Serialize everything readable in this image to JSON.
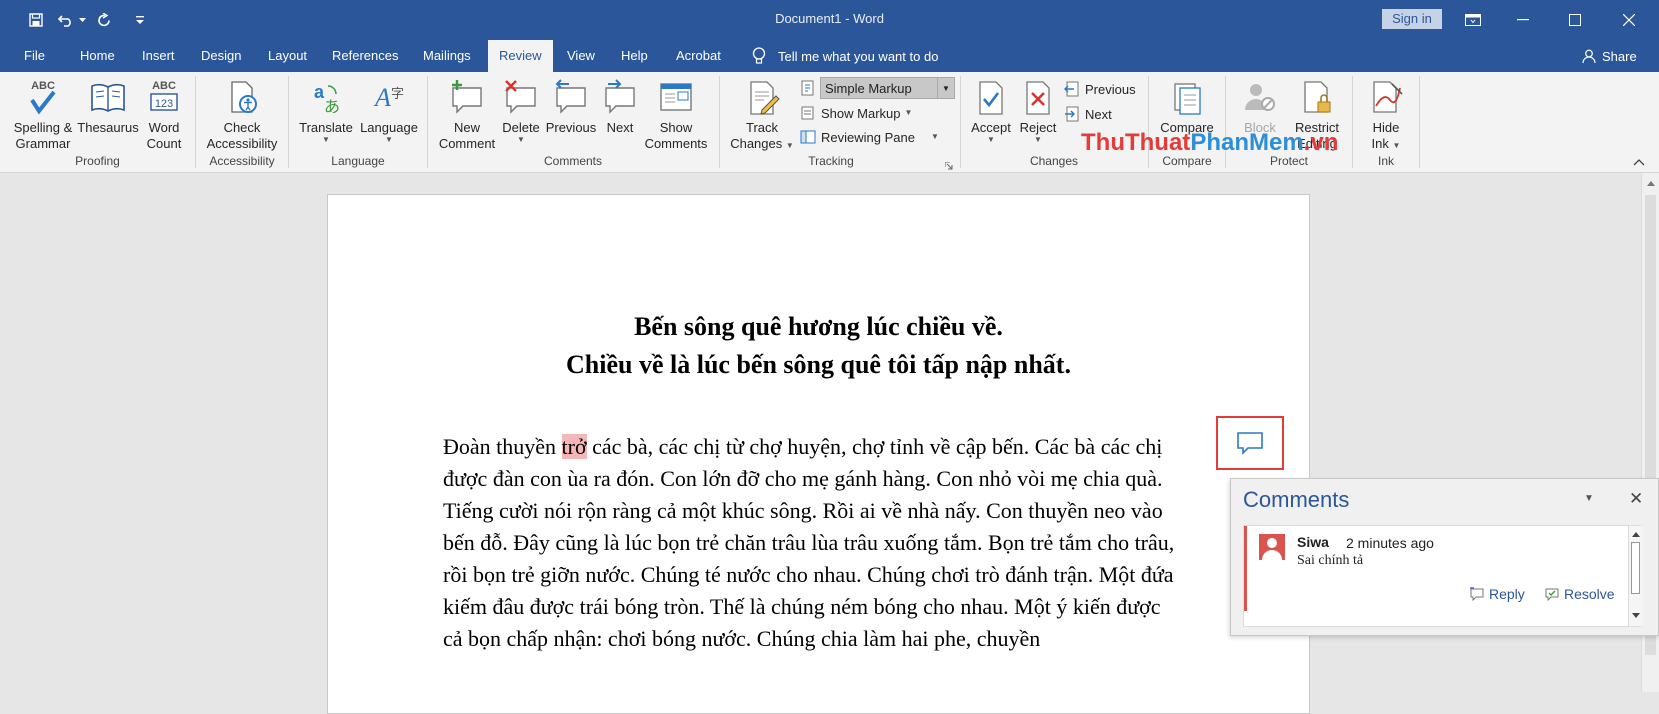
{
  "window": {
    "title": "Document1  -  Word",
    "signin": "Sign in"
  },
  "tabs": [
    {
      "label": "File",
      "active": false
    },
    {
      "label": "Home",
      "active": false
    },
    {
      "label": "Insert",
      "active": false
    },
    {
      "label": "Design",
      "active": false
    },
    {
      "label": "Layout",
      "active": false
    },
    {
      "label": "References",
      "active": false
    },
    {
      "label": "Mailings",
      "active": false
    },
    {
      "label": "Review",
      "active": true
    },
    {
      "label": "View",
      "active": false
    },
    {
      "label": "Help",
      "active": false
    },
    {
      "label": "Acrobat",
      "active": false
    }
  ],
  "tellme": "Tell me what you want to do",
  "share": "Share",
  "ribbon": {
    "proofing": {
      "group": "Proofing",
      "spelling": [
        "Spelling &",
        "Grammar"
      ],
      "spelling_icon_text": "ABC",
      "thesaurus": "Thesaurus",
      "wordcount": [
        "Word",
        "Count"
      ],
      "wordcount_icon_text": [
        "ABC",
        "123"
      ]
    },
    "accessibility": {
      "group": "Accessibility",
      "check": [
        "Check",
        "Accessibility"
      ]
    },
    "language": {
      "group": "Language",
      "translate": "Translate",
      "language": "Language"
    },
    "comments": {
      "group": "Comments",
      "new": [
        "New",
        "Comment"
      ],
      "delete": "Delete",
      "previous": "Previous",
      "next": "Next",
      "show": [
        "Show",
        "Comments"
      ]
    },
    "tracking": {
      "group": "Tracking",
      "track": [
        "Track",
        "Changes"
      ],
      "markup_value": "Simple Markup",
      "show_markup": "Show Markup",
      "reviewing_pane": "Reviewing Pane"
    },
    "changes": {
      "group": "Changes",
      "accept": "Accept",
      "reject": "Reject",
      "previous": "Previous",
      "next": "Next"
    },
    "compare": {
      "group": "Compare",
      "compare": "Compare"
    },
    "protect": {
      "group": "Protect",
      "block": "Block",
      "restrict": [
        "Restrict",
        "Editing"
      ]
    },
    "ink": {
      "group": "Ink",
      "hide": [
        "Hide",
        "Ink"
      ]
    }
  },
  "watermark": {
    "part1": "ThuThuat",
    "part2": "PhanMem",
    "part3": ".vn"
  },
  "document": {
    "heading1": "Bến sông quê hương lúc chiều về.",
    "heading2": "Chiều về là lúc bến sông quê tôi tấp nập nhất.",
    "para_start": "Đoàn thuyền ",
    "highlight": "trở",
    "para_rest": " các bà, các chị từ chợ huyện, chợ tỉnh về cập bến. Các bà các chị được đàn con ùa ra đón. Con lớn đỡ cho mẹ gánh hàng. Con nhỏ vòi mẹ chia quà. Tiếng cười nói rộn ràng cả một khúc sông. Rồi ai về nhà nấy. Con thuyền neo vào bến đỗ. Đây cũng là lúc bọn trẻ chăn trâu lùa trâu xuống tắm. Bọn trẻ tắm cho trâu, rồi bọn trẻ giỡn nước. Chúng té nước cho nhau. Chúng chơi trò đánh trận. Một đứa kiếm đâu được trái bóng tròn. Thế là chúng ném bóng cho nhau. Một ý kiến được cả bọn chấp nhận: chơi bóng nước. Chúng chia làm hai phe, chuyền"
  },
  "comments_pane": {
    "title": "Comments",
    "author": "Siwa",
    "time": "2 minutes ago",
    "text": "Sai chính tả",
    "reply": "Reply",
    "resolve": "Resolve"
  },
  "colors": {
    "accent": "#2b579a",
    "comment_marker": "#e23b3b",
    "highlight": "#f4b6b6"
  }
}
